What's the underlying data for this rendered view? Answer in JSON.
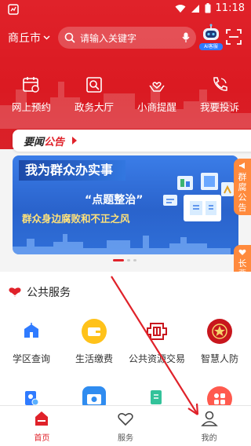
{
  "status_bar": {
    "time": "11:18"
  },
  "header": {
    "city": "商丘市",
    "search_placeholder": "请输入关键字",
    "ai_badge": "AI客服"
  },
  "quick_actions": [
    {
      "label": "网上预约",
      "icon": "calendar-clock-icon"
    },
    {
      "label": "政务大厅",
      "icon": "hall-icon"
    },
    {
      "label": "小商提醒",
      "icon": "heart-hands-icon"
    },
    {
      "label": "我要投诉",
      "icon": "phone-icon"
    }
  ],
  "notice": {
    "tag_black": "要闻",
    "tag_red": "公告"
  },
  "banner": {
    "title": "我为群众办实事",
    "slogan": "“点题整治”",
    "slogan2": "群众身边腐败和不正之风"
  },
  "side_tabs": {
    "tab1": "群腐公告",
    "tab2": "长辈版"
  },
  "services": {
    "title": "公共服务",
    "items": [
      {
        "label": "学区查询",
        "icon": "school-icon"
      },
      {
        "label": "生活缴费",
        "icon": "wallet-icon"
      },
      {
        "label": "公共资源交易",
        "icon": "trade-icon"
      },
      {
        "label": "智慧人防",
        "icon": "civil-defense-icon"
      }
    ],
    "row2_icons": [
      "id-card-icon",
      "camera-icon",
      "document-icon",
      "more-apps-icon"
    ]
  },
  "tabbar": [
    {
      "label": "首页",
      "icon": "home-icon",
      "active": true
    },
    {
      "label": "服务",
      "icon": "heart-icon",
      "active": false
    },
    {
      "label": "我的",
      "icon": "user-icon",
      "active": false
    }
  ],
  "colors": {
    "brand": "#e0222a",
    "accent_orange": "#ff8a3d",
    "banner_blue": "#2f6fd8"
  }
}
